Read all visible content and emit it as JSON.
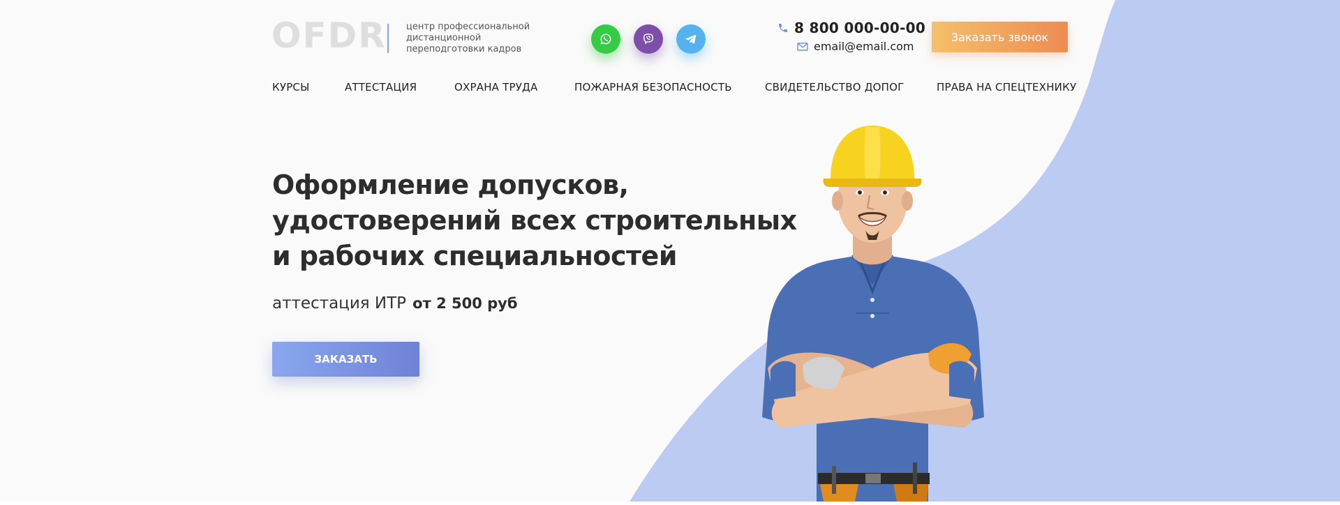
{
  "header": {
    "logo": "OFDR",
    "tagline": "центр профессиональной дистанционной переподготовки кадров",
    "socials": [
      {
        "name": "whatsapp",
        "icon": "whatsapp-icon",
        "color": "#35cc45"
      },
      {
        "name": "viber",
        "icon": "viber-icon",
        "color": "#7d4fa8"
      },
      {
        "name": "telegram",
        "icon": "telegram-icon",
        "color": "#54b3ee"
      }
    ],
    "phone": "8 800 000-00-00",
    "email": "email@email.com",
    "callback_label": "Заказать звонок"
  },
  "nav": {
    "items": [
      {
        "label": "КУРСЫ"
      },
      {
        "label": "АТТЕСТАЦИЯ"
      },
      {
        "label": "ОХРАНА ТРУДА"
      },
      {
        "label": "ПОЖАРНАЯ БЕЗОПАСНОСТЬ"
      },
      {
        "label": "СВИДЕТЕЛЬСТВО ДОПОГ"
      },
      {
        "label": "ПРАВА НА СПЕЦТЕХНИКУ"
      }
    ]
  },
  "hero": {
    "title_lines": [
      "Оформление допусков,",
      "удостоверений всех строительных",
      "и  рабочих специальностей"
    ],
    "subtitle": "аттестация ИТР",
    "price": "от 2 500 руб",
    "order_label": "ЗАКАЗАТЬ"
  },
  "colors": {
    "accent_blue": "#bccbf2",
    "button_blue": "#6f82d6",
    "button_orange": "#ee8b52",
    "background": "#fafafa"
  }
}
